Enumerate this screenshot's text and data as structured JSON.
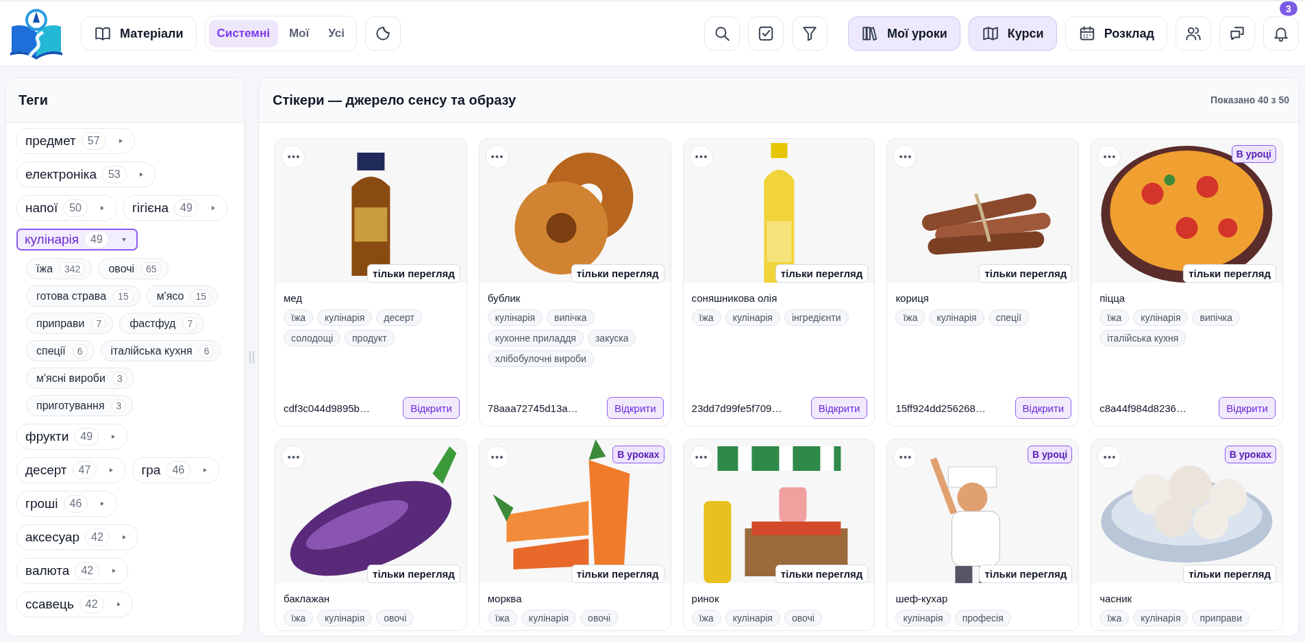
{
  "header": {
    "materials_button": "Матеріали",
    "source_tabs": [
      {
        "label": "Системні",
        "selected": true
      },
      {
        "label": "Мої",
        "selected": false
      },
      {
        "label": "Усі",
        "selected": false
      }
    ],
    "nav": [
      {
        "label": "Мої уроки",
        "selected": true,
        "kind": "books"
      },
      {
        "label": "Курси",
        "selected": true,
        "kind": "map"
      },
      {
        "label": "Розклад",
        "selected": false,
        "kind": "calendar"
      }
    ],
    "notifications_badge": "3"
  },
  "sidebar": {
    "title": "Теги",
    "tags": [
      {
        "label": "предмет",
        "count": "57",
        "expanded": false
      },
      {
        "label": "електроніка",
        "count": "53",
        "expanded": false
      },
      {
        "label": "напої",
        "count": "50",
        "expanded": false
      },
      {
        "label": "гігієна",
        "count": "49",
        "expanded": false
      },
      {
        "label": "кулінарія",
        "count": "49",
        "expanded": true,
        "children": [
          {
            "label": "їжа",
            "count": "342"
          },
          {
            "label": "овочі",
            "count": "65"
          },
          {
            "label": "готова страва",
            "count": "15"
          },
          {
            "label": "м'ясо",
            "count": "15"
          },
          {
            "label": "приправи",
            "count": "7"
          },
          {
            "label": "фастфуд",
            "count": "7"
          },
          {
            "label": "спеції",
            "count": "6"
          },
          {
            "label": "італійська кухня",
            "count": "6"
          },
          {
            "label": "м'ясні вироби",
            "count": "3"
          },
          {
            "label": "приготування",
            "count": "3"
          }
        ]
      },
      {
        "label": "фрукти",
        "count": "49",
        "expanded": false
      },
      {
        "label": "десерт",
        "count": "47",
        "expanded": false
      },
      {
        "label": "гра",
        "count": "46",
        "expanded": false
      },
      {
        "label": "гроші",
        "count": "46",
        "expanded": false
      },
      {
        "label": "аксесуар",
        "count": "42",
        "expanded": false
      },
      {
        "label": "валюта",
        "count": "42",
        "expanded": false
      },
      {
        "label": "ссавець",
        "count": "42",
        "expanded": false
      }
    ]
  },
  "main": {
    "title": "Стікери — джерело сенсу та образу",
    "shown": "Показано 40 з 50",
    "cards": [
      {
        "kind": "picture",
        "title": "мед",
        "access": "тільки перегляд",
        "tags": [
          "їжа",
          "кулінарія",
          "десерт",
          "солодощі",
          "продукт"
        ],
        "id": "cdf3c044d9895b…",
        "open_button": "Відкрити"
      },
      {
        "kind": "picture",
        "title": "бублик",
        "access": "тільки перегляд",
        "tags": [
          "кулінарія",
          "випічка",
          "кухонне приладдя",
          "закуска",
          "хлібобулочні вироби"
        ],
        "id": "78aaa72745d13a…",
        "open_button": "Відкрити"
      },
      {
        "kind": "picture",
        "title": "соняшникова олія",
        "access": "тільки перегляд",
        "tags": [
          "їжа",
          "кулінарія",
          "інгредієнти"
        ],
        "id": "23dd7d99fe5f709…",
        "open_button": "Відкрити"
      },
      {
        "kind": "picture",
        "title": "кориця",
        "access": "тільки перегляд",
        "tags": [
          "їжа",
          "кулінарія",
          "спеції"
        ],
        "id": "15ff924dd256268…",
        "open_button": "Відкрити"
      },
      {
        "kind": "picture",
        "title": "піцца",
        "access": "тільки перегляд",
        "usage": "В уроці",
        "tags": [
          "їжа",
          "кулінарія",
          "випічка",
          "італійська кухня"
        ],
        "id": "c8a44f984d8236…",
        "open_button": "Відкрити"
      },
      {
        "kind": "picture",
        "title": "баклажан",
        "access": "тільки перегляд",
        "tags": [
          "їжа",
          "кулінарія",
          "овочі"
        ]
      },
      {
        "kind": "picture",
        "title": "морква",
        "access": "тільки перегляд",
        "usage": "В уроках",
        "tags": [
          "їжа",
          "кулінарія",
          "овочі"
        ]
      },
      {
        "kind": "picture",
        "title": "ринок",
        "access": "тільки перегляд",
        "tags": [
          "їжа",
          "кулінарія",
          "овочі"
        ]
      },
      {
        "kind": "picture",
        "title": "шеф-кухар",
        "access": "тільки перегляд",
        "usage": "В уроці",
        "tags": [
          "кулінарія",
          "професія"
        ]
      },
      {
        "kind": "picture",
        "title": "часник",
        "access": "тільки перегляд",
        "usage": "В уроках",
        "tags": [
          "їжа",
          "кулінарія",
          "приправи"
        ]
      }
    ]
  }
}
